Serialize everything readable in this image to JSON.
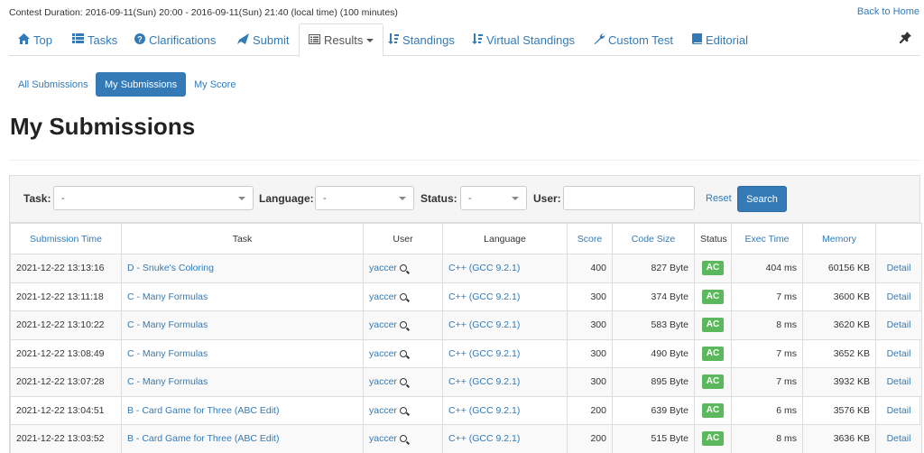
{
  "header": {
    "duration": "Contest Duration: 2016-09-11(Sun) 20:00 - 2016-09-11(Sun) 21:40 (local time) (100 minutes)",
    "back_home": "Back to Home"
  },
  "nav": {
    "tabs": [
      {
        "label": "Top",
        "icon": "home-icon"
      },
      {
        "label": "Tasks",
        "icon": "list-icon"
      },
      {
        "label": "Clarifications",
        "icon": "question-circle-icon"
      },
      {
        "label": "Submit",
        "icon": "send-icon"
      },
      {
        "label": "Results",
        "icon": "list-alt-icon"
      },
      {
        "label": "Standings",
        "icon": "sort-icon"
      },
      {
        "label": "Virtual Standings",
        "icon": "sort-icon"
      },
      {
        "label": "Custom Test",
        "icon": "wrench-icon"
      },
      {
        "label": "Editorial",
        "icon": "book-icon"
      }
    ],
    "active": "Results"
  },
  "subnav": {
    "items": [
      "All Submissions",
      "My Submissions",
      "My Score"
    ],
    "active": "My Submissions"
  },
  "page_title": "My Submissions",
  "filter": {
    "task_label": "Task:",
    "task_value": "-",
    "language_label": "Language:",
    "language_value": "-",
    "status_label": "Status:",
    "status_value": "-",
    "user_label": "User:",
    "user_value": "",
    "reset_label": "Reset",
    "search_label": "Search"
  },
  "table": {
    "headers": [
      "Submission Time",
      "Task",
      "User",
      "Language",
      "Score",
      "Code Size",
      "Status",
      "Exec Time",
      "Memory",
      ""
    ],
    "rows": [
      {
        "time": "2021-12-22 13:13:16",
        "task": "D - Snuke's Coloring",
        "user": "yaccer",
        "language": "C++ (GCC 9.2.1)",
        "score": "400",
        "size": "827 Byte",
        "status": "AC",
        "exec": "404 ms",
        "memory": "60156 KB",
        "detail": "Detail"
      },
      {
        "time": "2021-12-22 13:11:18",
        "task": "C - Many Formulas",
        "user": "yaccer",
        "language": "C++ (GCC 9.2.1)",
        "score": "300",
        "size": "374 Byte",
        "status": "AC",
        "exec": "7 ms",
        "memory": "3600 KB",
        "detail": "Detail"
      },
      {
        "time": "2021-12-22 13:10:22",
        "task": "C - Many Formulas",
        "user": "yaccer",
        "language": "C++ (GCC 9.2.1)",
        "score": "300",
        "size": "583 Byte",
        "status": "AC",
        "exec": "8 ms",
        "memory": "3620 KB",
        "detail": "Detail"
      },
      {
        "time": "2021-12-22 13:08:49",
        "task": "C - Many Formulas",
        "user": "yaccer",
        "language": "C++ (GCC 9.2.1)",
        "score": "300",
        "size": "490 Byte",
        "status": "AC",
        "exec": "7 ms",
        "memory": "3652 KB",
        "detail": "Detail"
      },
      {
        "time": "2021-12-22 13:07:28",
        "task": "C - Many Formulas",
        "user": "yaccer",
        "language": "C++ (GCC 9.2.1)",
        "score": "300",
        "size": "895 Byte",
        "status": "AC",
        "exec": "7 ms",
        "memory": "3932 KB",
        "detail": "Detail"
      },
      {
        "time": "2021-12-22 13:04:51",
        "task": "B - Card Game for Three (ABC Edit)",
        "user": "yaccer",
        "language": "C++ (GCC 9.2.1)",
        "score": "200",
        "size": "639 Byte",
        "status": "AC",
        "exec": "6 ms",
        "memory": "3576 KB",
        "detail": "Detail"
      },
      {
        "time": "2021-12-22 13:03:52",
        "task": "B - Card Game for Three (ABC Edit)",
        "user": "yaccer",
        "language": "C++ (GCC 9.2.1)",
        "score": "200",
        "size": "515 Byte",
        "status": "AC",
        "exec": "8 ms",
        "memory": "3636 KB",
        "detail": "Detail"
      }
    ]
  }
}
